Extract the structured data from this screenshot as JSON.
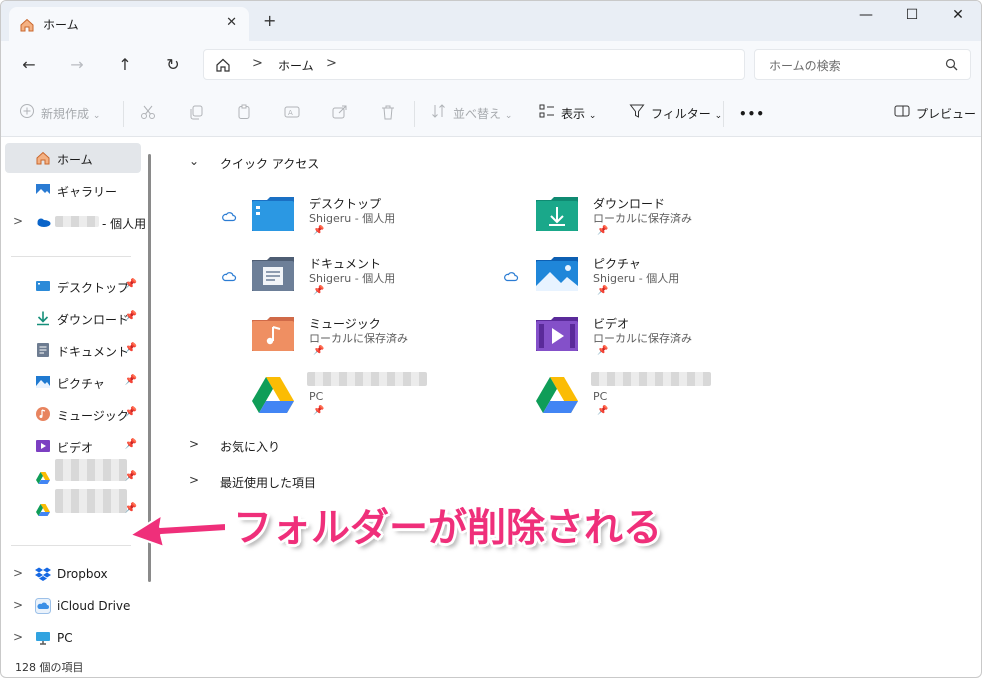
{
  "window": {
    "tab_title": "ホーム",
    "tab_close": "✕",
    "new_tab": "+",
    "controls": {
      "minimize": "—",
      "maximize": "☐",
      "close": "✕"
    }
  },
  "address": {
    "back": "←",
    "forward": "→",
    "up": "↑",
    "refresh": "↻",
    "separator": ">",
    "crumb": "ホーム",
    "search_placeholder": "ホームの検索"
  },
  "toolbar": {
    "new_label": "新規作成",
    "sort_label": "並べ替え",
    "view_label": "表示",
    "filter_label": "フィルター",
    "more_label": "•••",
    "preview_label": "プレビュー"
  },
  "sidebar": {
    "top_items": [
      {
        "label": "ホーム",
        "icon": "home-icon",
        "selected": true
      },
      {
        "label": "ギャラリー",
        "icon": "gallery-icon"
      },
      {
        "label": "- 個人用",
        "icon": "onedrive-icon",
        "expandable": true
      }
    ],
    "pinned_items": [
      {
        "label": "デスクトップ",
        "icon": "desktop-icon"
      },
      {
        "label": "ダウンロード",
        "icon": "download-icon"
      },
      {
        "label": "ドキュメント",
        "icon": "documents-icon"
      },
      {
        "label": "ピクチャ",
        "icon": "pictures-icon"
      },
      {
        "label": "ミュージック",
        "icon": "music-icon"
      },
      {
        "label": "ビデオ",
        "icon": "videos-icon"
      },
      {
        "label": "",
        "icon": "google-drive-icon"
      },
      {
        "label": "",
        "icon": "google-drive-icon"
      }
    ],
    "bottom_items": [
      {
        "label": "Dropbox",
        "icon": "dropbox-icon"
      },
      {
        "label": "iCloud Drive",
        "icon": "icloud-icon"
      },
      {
        "label": "PC",
        "icon": "pc-icon"
      }
    ],
    "pin_glyph": "📌"
  },
  "content": {
    "quick_access": {
      "header": "クイック アクセス",
      "items": [
        {
          "name": "デスクトップ",
          "sub": "Shigeru - 個人用",
          "icon": "desktop-folder-icon",
          "cloud": true
        },
        {
          "name": "ダウンロード",
          "sub": "ローカルに保存済み",
          "icon": "download-folder-icon",
          "cloud": false
        },
        {
          "name": "ドキュメント",
          "sub": "Shigeru - 個人用",
          "icon": "documents-folder-icon",
          "cloud": true
        },
        {
          "name": "ピクチャ",
          "sub": "Shigeru - 個人用",
          "icon": "pictures-folder-icon",
          "cloud": true
        },
        {
          "name": "ミュージック",
          "sub": "ローカルに保存済み",
          "icon": "music-folder-icon",
          "cloud": false
        },
        {
          "name": "ビデオ",
          "sub": "ローカルに保存済み",
          "icon": "videos-folder-icon",
          "cloud": false
        },
        {
          "name": "",
          "sub": "PC",
          "icon": "google-drive-icon",
          "cloud": false
        },
        {
          "name": "",
          "sub": "PC",
          "icon": "google-drive-icon",
          "cloud": false
        }
      ]
    },
    "favorites_header": "お気に入り",
    "recent_header": "最近使用した項目"
  },
  "status": {
    "count": "128 個の項目"
  },
  "annotation": {
    "text": "フォルダーが削除される",
    "color": "#ef2f7a"
  }
}
